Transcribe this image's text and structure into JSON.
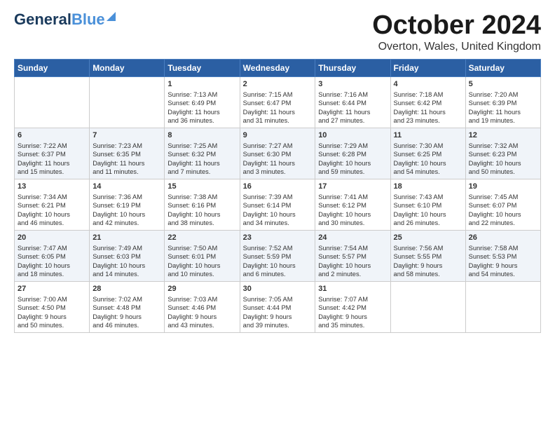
{
  "header": {
    "logo_line1": "General",
    "logo_line2": "Blue",
    "month_title": "October 2024",
    "location": "Overton, Wales, United Kingdom"
  },
  "days_of_week": [
    "Sunday",
    "Monday",
    "Tuesday",
    "Wednesday",
    "Thursday",
    "Friday",
    "Saturday"
  ],
  "weeks": [
    [
      {
        "day": "",
        "content": ""
      },
      {
        "day": "",
        "content": ""
      },
      {
        "day": "1",
        "content": "Sunrise: 7:13 AM\nSunset: 6:49 PM\nDaylight: 11 hours\nand 36 minutes."
      },
      {
        "day": "2",
        "content": "Sunrise: 7:15 AM\nSunset: 6:47 PM\nDaylight: 11 hours\nand 31 minutes."
      },
      {
        "day": "3",
        "content": "Sunrise: 7:16 AM\nSunset: 6:44 PM\nDaylight: 11 hours\nand 27 minutes."
      },
      {
        "day": "4",
        "content": "Sunrise: 7:18 AM\nSunset: 6:42 PM\nDaylight: 11 hours\nand 23 minutes."
      },
      {
        "day": "5",
        "content": "Sunrise: 7:20 AM\nSunset: 6:39 PM\nDaylight: 11 hours\nand 19 minutes."
      }
    ],
    [
      {
        "day": "6",
        "content": "Sunrise: 7:22 AM\nSunset: 6:37 PM\nDaylight: 11 hours\nand 15 minutes."
      },
      {
        "day": "7",
        "content": "Sunrise: 7:23 AM\nSunset: 6:35 PM\nDaylight: 11 hours\nand 11 minutes."
      },
      {
        "day": "8",
        "content": "Sunrise: 7:25 AM\nSunset: 6:32 PM\nDaylight: 11 hours\nand 7 minutes."
      },
      {
        "day": "9",
        "content": "Sunrise: 7:27 AM\nSunset: 6:30 PM\nDaylight: 11 hours\nand 3 minutes."
      },
      {
        "day": "10",
        "content": "Sunrise: 7:29 AM\nSunset: 6:28 PM\nDaylight: 10 hours\nand 59 minutes."
      },
      {
        "day": "11",
        "content": "Sunrise: 7:30 AM\nSunset: 6:25 PM\nDaylight: 10 hours\nand 54 minutes."
      },
      {
        "day": "12",
        "content": "Sunrise: 7:32 AM\nSunset: 6:23 PM\nDaylight: 10 hours\nand 50 minutes."
      }
    ],
    [
      {
        "day": "13",
        "content": "Sunrise: 7:34 AM\nSunset: 6:21 PM\nDaylight: 10 hours\nand 46 minutes."
      },
      {
        "day": "14",
        "content": "Sunrise: 7:36 AM\nSunset: 6:19 PM\nDaylight: 10 hours\nand 42 minutes."
      },
      {
        "day": "15",
        "content": "Sunrise: 7:38 AM\nSunset: 6:16 PM\nDaylight: 10 hours\nand 38 minutes."
      },
      {
        "day": "16",
        "content": "Sunrise: 7:39 AM\nSunset: 6:14 PM\nDaylight: 10 hours\nand 34 minutes."
      },
      {
        "day": "17",
        "content": "Sunrise: 7:41 AM\nSunset: 6:12 PM\nDaylight: 10 hours\nand 30 minutes."
      },
      {
        "day": "18",
        "content": "Sunrise: 7:43 AM\nSunset: 6:10 PM\nDaylight: 10 hours\nand 26 minutes."
      },
      {
        "day": "19",
        "content": "Sunrise: 7:45 AM\nSunset: 6:07 PM\nDaylight: 10 hours\nand 22 minutes."
      }
    ],
    [
      {
        "day": "20",
        "content": "Sunrise: 7:47 AM\nSunset: 6:05 PM\nDaylight: 10 hours\nand 18 minutes."
      },
      {
        "day": "21",
        "content": "Sunrise: 7:49 AM\nSunset: 6:03 PM\nDaylight: 10 hours\nand 14 minutes."
      },
      {
        "day": "22",
        "content": "Sunrise: 7:50 AM\nSunset: 6:01 PM\nDaylight: 10 hours\nand 10 minutes."
      },
      {
        "day": "23",
        "content": "Sunrise: 7:52 AM\nSunset: 5:59 PM\nDaylight: 10 hours\nand 6 minutes."
      },
      {
        "day": "24",
        "content": "Sunrise: 7:54 AM\nSunset: 5:57 PM\nDaylight: 10 hours\nand 2 minutes."
      },
      {
        "day": "25",
        "content": "Sunrise: 7:56 AM\nSunset: 5:55 PM\nDaylight: 9 hours\nand 58 minutes."
      },
      {
        "day": "26",
        "content": "Sunrise: 7:58 AM\nSunset: 5:53 PM\nDaylight: 9 hours\nand 54 minutes."
      }
    ],
    [
      {
        "day": "27",
        "content": "Sunrise: 7:00 AM\nSunset: 4:50 PM\nDaylight: 9 hours\nand 50 minutes."
      },
      {
        "day": "28",
        "content": "Sunrise: 7:02 AM\nSunset: 4:48 PM\nDaylight: 9 hours\nand 46 minutes."
      },
      {
        "day": "29",
        "content": "Sunrise: 7:03 AM\nSunset: 4:46 PM\nDaylight: 9 hours\nand 43 minutes."
      },
      {
        "day": "30",
        "content": "Sunrise: 7:05 AM\nSunset: 4:44 PM\nDaylight: 9 hours\nand 39 minutes."
      },
      {
        "day": "31",
        "content": "Sunrise: 7:07 AM\nSunset: 4:42 PM\nDaylight: 9 hours\nand 35 minutes."
      },
      {
        "day": "",
        "content": ""
      },
      {
        "day": "",
        "content": ""
      }
    ]
  ]
}
